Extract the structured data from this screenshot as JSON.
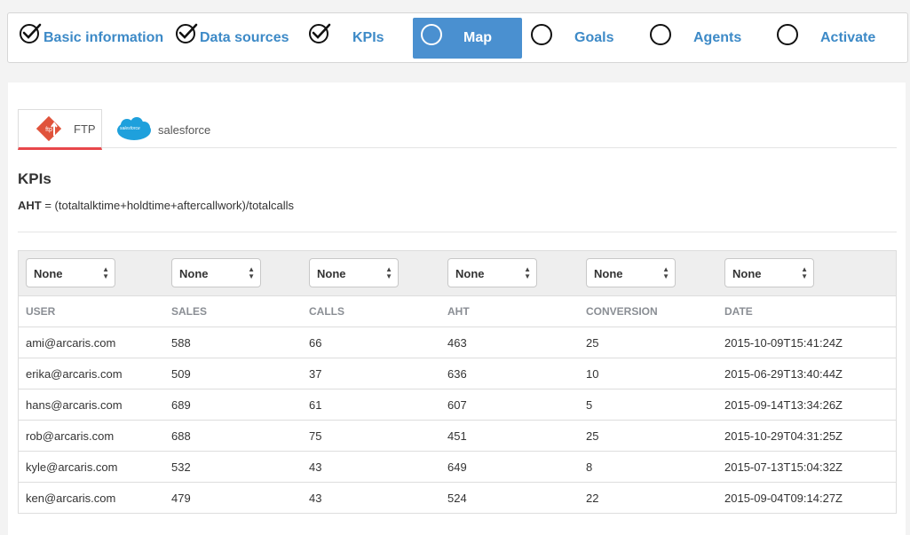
{
  "stepper": {
    "steps": [
      {
        "label": "Basic information",
        "state": "done"
      },
      {
        "label": "Data sources",
        "state": "done"
      },
      {
        "label": "KPIs",
        "state": "done"
      },
      {
        "label": "Map",
        "state": "active"
      },
      {
        "label": "Goals",
        "state": "todo"
      },
      {
        "label": "Agents",
        "state": "todo"
      },
      {
        "label": "Activate",
        "state": "todo"
      }
    ]
  },
  "sources": {
    "tabs": [
      {
        "label": "FTP",
        "icon": "ftp-icon",
        "active": true
      },
      {
        "label": "salesforce",
        "icon": "salesforce-logo",
        "logo_text": "salesforce",
        "active": false
      }
    ]
  },
  "kpis": {
    "title": "KPIs",
    "formula_name": "AHT",
    "formula_expr": " = (totaltalktime+holdtime+aftercallwork)/totalcalls"
  },
  "mapping": {
    "selects": [
      "None",
      "None",
      "None",
      "None",
      "None",
      "None"
    ],
    "columns": [
      "USER",
      "SALES",
      "CALLS",
      "AHT",
      "CONVERSION",
      "DATE"
    ],
    "rows": [
      [
        "ami@arcaris.com",
        "588",
        "66",
        "463",
        "25",
        "2015-10-09T15:41:24Z"
      ],
      [
        "erika@arcaris.com",
        "509",
        "37",
        "636",
        "10",
        "2015-06-29T13:40:44Z"
      ],
      [
        "hans@arcaris.com",
        "689",
        "61",
        "607",
        "5",
        "2015-09-14T13:34:26Z"
      ],
      [
        "rob@arcaris.com",
        "688",
        "75",
        "451",
        "25",
        "2015-10-29T04:31:25Z"
      ],
      [
        "kyle@arcaris.com",
        "532",
        "43",
        "649",
        "8",
        "2015-07-13T15:04:32Z"
      ],
      [
        "ken@arcaris.com",
        "479",
        "43",
        "524",
        "22",
        "2015-09-04T09:14:27Z"
      ]
    ]
  },
  "colors": {
    "accent": "#4a90d0",
    "link": "#3d8ac7",
    "tab_underline": "#e8474b",
    "ftp_red": "#e0533b",
    "salesforce_blue": "#1ea0dc"
  }
}
